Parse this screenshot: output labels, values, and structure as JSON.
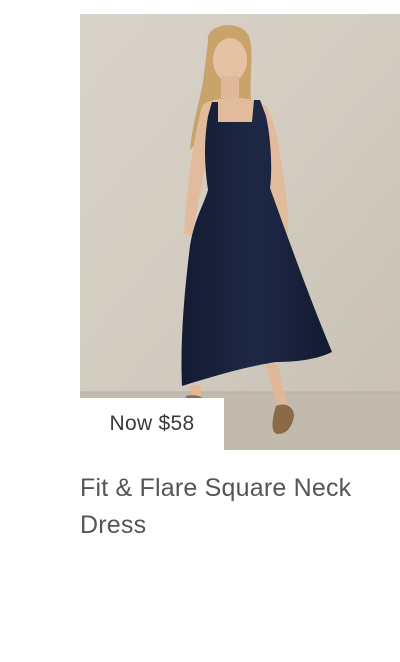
{
  "product": {
    "price_label": "Now $58",
    "name": "Fit & Flare Square Neck Dress",
    "image": {
      "subject": "product-photo-navy-dress",
      "background_color": "#d4cdc3",
      "floor_color": "#c4bbaf",
      "dress_color": "#1b2440"
    }
  }
}
